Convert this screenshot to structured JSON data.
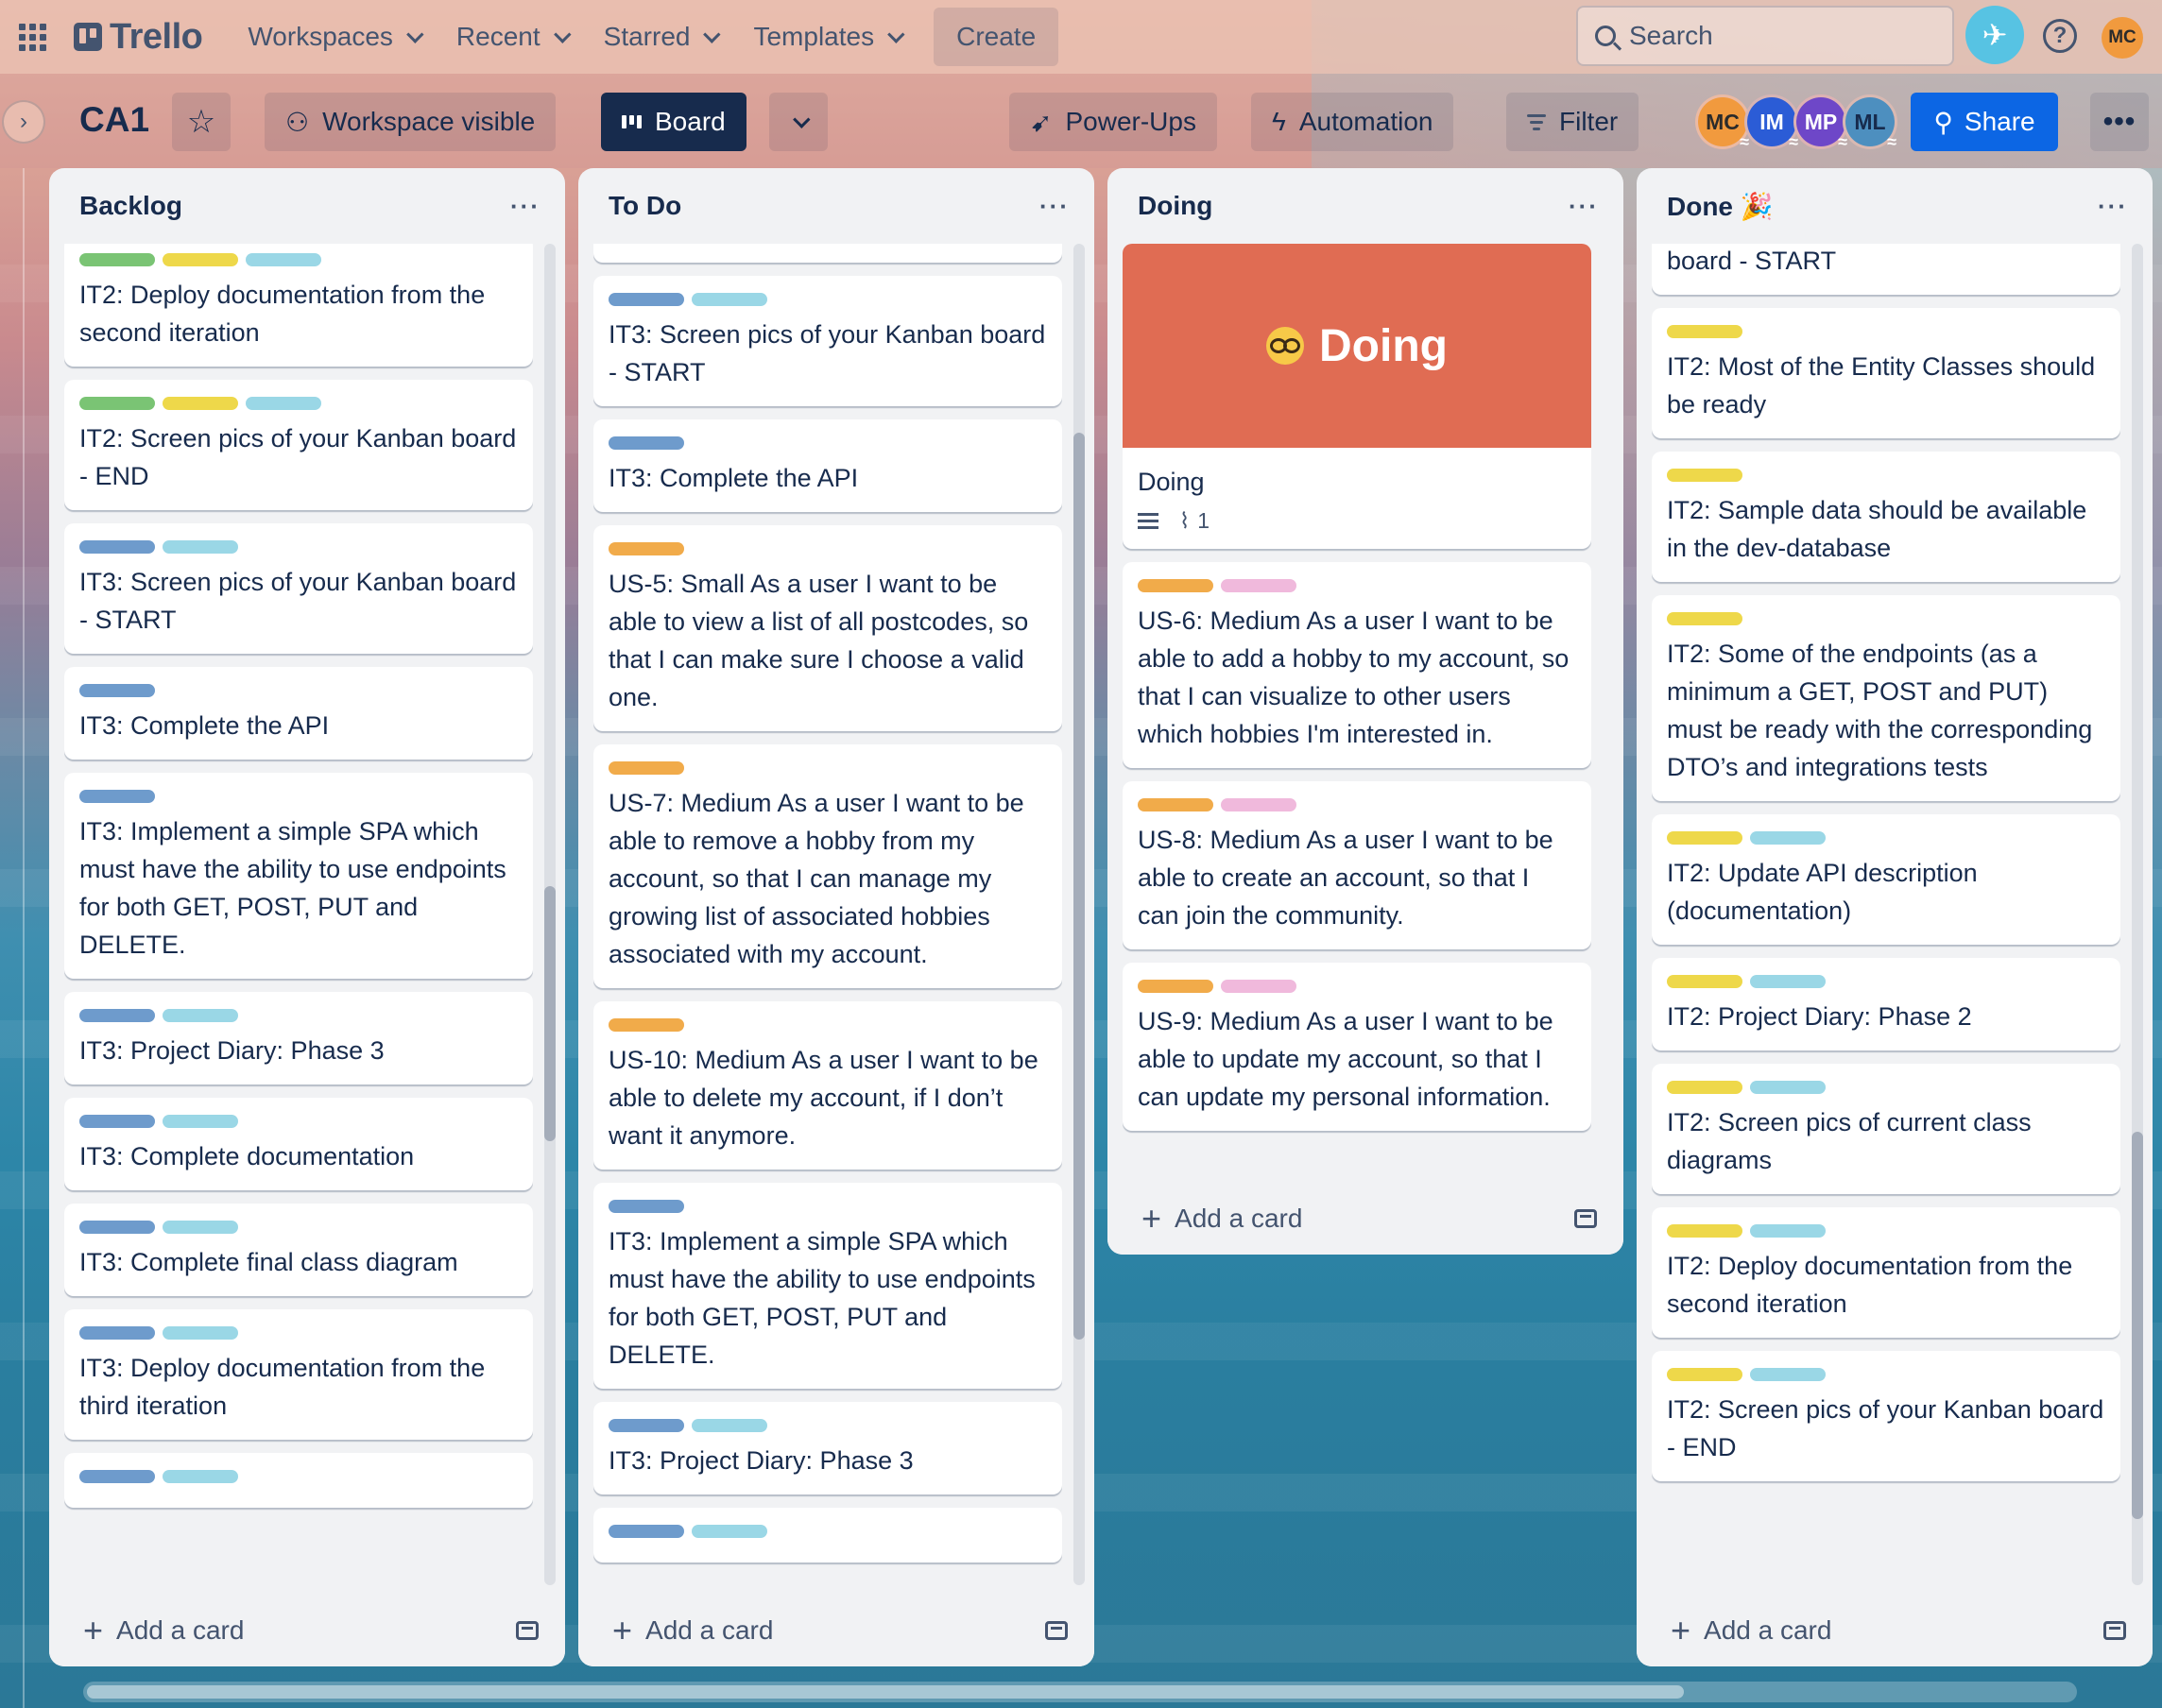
{
  "app": "Trello",
  "topnav": {
    "menus": [
      "Workspaces",
      "Recent",
      "Starred",
      "Templates"
    ],
    "create": "Create",
    "search": "Search",
    "help": "?",
    "me": "MC"
  },
  "board": {
    "title": "CA1",
    "visibility": "Workspace visible",
    "view": "Board",
    "powerups": "Power-Ups",
    "automation": "Automation",
    "filter": "Filter",
    "members": [
      "MC",
      "IM",
      "MP",
      "ML"
    ],
    "share": "Share"
  },
  "lists": [
    {
      "title": "Backlog",
      "add": "Add a card",
      "cards": [
        {
          "labels": [
            "green",
            "yellow",
            "sky"
          ],
          "title": "IT2: Deploy documentation from the second iteration"
        },
        {
          "labels": [
            "green",
            "yellow",
            "sky"
          ],
          "title": "IT2: Screen pics of your Kanban board - END"
        },
        {
          "labels": [
            "blue",
            "sky"
          ],
          "title": "IT3: Screen pics of your Kanban board - START"
        },
        {
          "labels": [
            "blue"
          ],
          "title": "IT3: Complete the API"
        },
        {
          "labels": [
            "blue"
          ],
          "title": "IT3: Implement a simple SPA which must have the ability to use endpoints for both GET, POST, PUT and DELETE."
        },
        {
          "labels": [
            "blue",
            "sky"
          ],
          "title": "IT3: Project Diary: Phase 3"
        },
        {
          "labels": [
            "blue",
            "sky"
          ],
          "title": "IT3: Complete documentation"
        },
        {
          "labels": [
            "blue",
            "sky"
          ],
          "title": "IT3: Complete final class diagram"
        },
        {
          "labels": [
            "blue",
            "sky"
          ],
          "title": "IT3: Deploy documentation from the third iteration"
        },
        {
          "labels": [
            "blue",
            "sky"
          ],
          "title": ""
        }
      ]
    },
    {
      "title": "To Do",
      "add": "Add a card",
      "cards": [
        {
          "labels": [
            "blue",
            "sky"
          ],
          "title": "IT3: Screen pics of your Kanban board - START"
        },
        {
          "labels": [
            "blue"
          ],
          "title": "IT3: Complete the API"
        },
        {
          "labels": [
            "orange"
          ],
          "title": "US-5: Small As a user I want to be able to view a list of all postcodes, so that I can make sure I choose a valid one."
        },
        {
          "labels": [
            "orange"
          ],
          "title": "US-7: Medium As a user I want to be able to remove a hobby from my account, so that I can manage my growing list of associated hobbies associated with my account."
        },
        {
          "labels": [
            "orange"
          ],
          "title": "US-10: Medium As a user I want to be able to delete my account, if I don’t want it anymore."
        },
        {
          "labels": [
            "blue"
          ],
          "title": "IT3: Implement a simple SPA which must have the ability to use endpoints for both GET, POST, PUT and DELETE."
        },
        {
          "labels": [
            "blue",
            "sky"
          ],
          "title": "IT3: Project Diary: Phase 3"
        },
        {
          "labels": [
            "blue",
            "sky"
          ],
          "title": ""
        }
      ]
    },
    {
      "title": "Doing",
      "add": "Add a card",
      "cover": {
        "text": "Doing"
      },
      "cards": [
        {
          "labels": [],
          "title": "Doing",
          "attachments": "1",
          "cover": true
        },
        {
          "labels": [
            "orange",
            "pink"
          ],
          "title": "US-6: Medium As a user I want to be able to add a hobby to my account, so that I can visualize to other users which hobbies I'm interested in."
        },
        {
          "labels": [
            "orange",
            "pink"
          ],
          "title": "US-8: Medium As a user I want to be able to create an account, so that I can join the community."
        },
        {
          "labels": [
            "orange",
            "pink"
          ],
          "title": "US-9: Medium As a user I want to be able to update my account, so that I can update my personal information."
        }
      ]
    },
    {
      "title": "Done 🎉",
      "add": "Add a card",
      "cards": [
        {
          "labels": [],
          "title": "board - START"
        },
        {
          "labels": [
            "yellow"
          ],
          "title": "IT2: Most of the Entity Classes should be ready"
        },
        {
          "labels": [
            "yellow"
          ],
          "title": "IT2: Sample data should be available in the dev-database"
        },
        {
          "labels": [
            "yellow"
          ],
          "title": "IT2: Some of the endpoints (as a minimum a GET, POST and PUT) must be ready with the corresponding DTO’s and integrations tests"
        },
        {
          "labels": [
            "yellow",
            "sky"
          ],
          "title": "IT2: Update API description (documentation)"
        },
        {
          "labels": [
            "yellow",
            "sky"
          ],
          "title": "IT2: Project Diary: Phase 2"
        },
        {
          "labels": [
            "yellow",
            "sky"
          ],
          "title": "IT2: Screen pics of current class diagrams"
        },
        {
          "labels": [
            "yellow",
            "sky"
          ],
          "title": "IT2: Deploy documentation from the second iteration"
        },
        {
          "labels": [
            "yellow",
            "sky"
          ],
          "title": "IT2: Screen pics of your Kanban board - END"
        }
      ]
    }
  ]
}
